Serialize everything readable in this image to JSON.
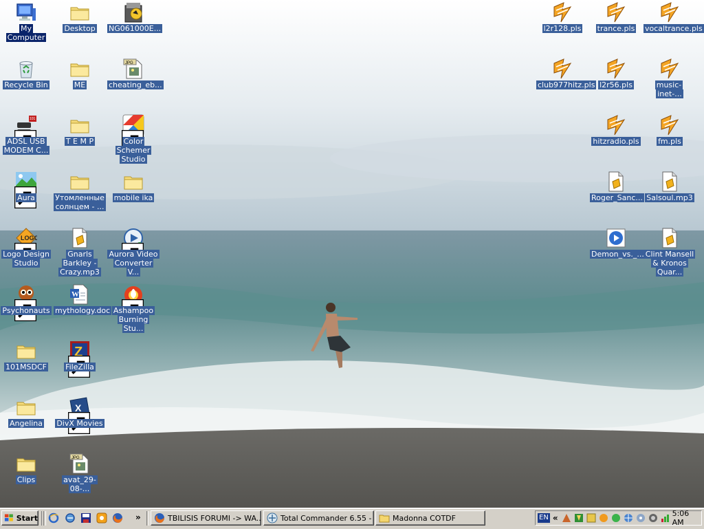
{
  "desktop": {
    "icons": [
      {
        "label": "My Computer",
        "icon": "computer-icon",
        "shortcut": false,
        "selected": true
      },
      {
        "label": "Recycle Bin",
        "icon": "recycle-bin-icon",
        "shortcut": false
      },
      {
        "label": "ADSL USB MODEM C...",
        "icon": "modem-icon",
        "shortcut": true
      },
      {
        "label": "Aura",
        "icon": "landscape-icon",
        "shortcut": true
      },
      {
        "label": "Logo Design Studio",
        "icon": "logo-icon",
        "shortcut": true
      },
      {
        "label": "Psychonauts",
        "icon": "game-character-icon",
        "shortcut": true
      },
      {
        "label": "101MSDCF",
        "icon": "folder-icon",
        "shortcut": false
      },
      {
        "label": "Angelina",
        "icon": "folder-icon",
        "shortcut": false
      },
      {
        "label": "Clips",
        "icon": "folder-icon",
        "shortcut": false
      },
      {
        "label": "Desktop",
        "icon": "folder-icon",
        "shortcut": false
      },
      {
        "label": "ME",
        "icon": "folder-icon",
        "shortcut": false
      },
      {
        "label": "T E M P",
        "icon": "folder-icon",
        "shortcut": false
      },
      {
        "label": "Утомленные солнцем - ...",
        "icon": "folder-icon",
        "shortcut": false
      },
      {
        "label": "Gnarls Barkley - Crazy.mp3",
        "icon": "audio-file-icon",
        "shortcut": false
      },
      {
        "label": "mythology.doc",
        "icon": "word-doc-icon",
        "shortcut": false
      },
      {
        "label": "FileZilla",
        "icon": "filezilla-icon",
        "shortcut": true
      },
      {
        "label": "DivX Movies",
        "icon": "divx-icon",
        "shortcut": true
      },
      {
        "label": "avat_29-08-...",
        "icon": "jpg-file-icon",
        "shortcut": false
      },
      {
        "label": "NG061000E...",
        "icon": "archive-icon",
        "shortcut": false
      },
      {
        "label": "cheating_eb...",
        "icon": "jpg-file-icon",
        "shortcut": false
      },
      {
        "label": "Color Schemer Studio",
        "icon": "color-schemer-icon",
        "shortcut": true
      },
      {
        "label": "mobile ika",
        "icon": "folder-icon",
        "shortcut": false
      },
      {
        "label": "Aurora Video Converter V...",
        "icon": "video-converter-icon",
        "shortcut": true
      },
      {
        "label": "Ashampoo Burning Stu...",
        "icon": "burning-disc-icon",
        "shortcut": true
      },
      {
        "label": "l2r128.pls",
        "icon": "winamp-playlist-icon",
        "shortcut": false
      },
      {
        "label": "club977hitz.pls",
        "icon": "winamp-playlist-icon",
        "shortcut": false
      },
      {
        "label": "trance.pls",
        "icon": "winamp-playlist-icon",
        "shortcut": false
      },
      {
        "label": "l2r56.pls",
        "icon": "winamp-playlist-icon",
        "shortcut": false
      },
      {
        "label": "hitzradio.pls",
        "icon": "winamp-playlist-icon",
        "shortcut": false
      },
      {
        "label": "Roger_Sanc...",
        "icon": "audio-file-icon",
        "shortcut": false
      },
      {
        "label": "Demon_vs._...",
        "icon": "media-file-icon",
        "shortcut": false
      },
      {
        "label": "vocaltrance.pls",
        "icon": "winamp-playlist-icon",
        "shortcut": false
      },
      {
        "label": "music-inet-...",
        "icon": "winamp-playlist-icon",
        "shortcut": false
      },
      {
        "label": "fm.pls",
        "icon": "winamp-playlist-icon",
        "shortcut": false
      },
      {
        "label": "Salsoul.mp3",
        "icon": "audio-file-icon",
        "shortcut": false
      },
      {
        "label": "Clint Mansell & Kronos Quar...",
        "icon": "audio-file-icon",
        "shortcut": false
      }
    ]
  },
  "taskbar": {
    "start_label": "Start",
    "quick_launch": [
      "ie-icon",
      "ie-icon",
      "save-icon",
      "orange-app-icon",
      "firefox-icon"
    ],
    "chevron": "»",
    "tasks": [
      {
        "label": "TBILISIS FORUMI -> WA...",
        "icon": "firefox-icon"
      },
      {
        "label": "Total Commander 6.55 - ...",
        "icon": "total-commander-icon"
      },
      {
        "label": "Madonna COTDF",
        "icon": "folder-icon"
      }
    ],
    "tray": {
      "language": "EN",
      "expand": "«",
      "icons": [
        "app-tray-icon",
        "winamp-tray-icon",
        "green-tray-icon",
        "orange-tray-icon",
        "network-tray-icon",
        "globe-tray-icon",
        "disc-tray-icon",
        "volume-tray-icon",
        "signal-tray-icon"
      ],
      "clock": "5:06 AM"
    }
  },
  "colors": {
    "taskbar": "#d4d0c8",
    "label_bg": "#3a5f9a",
    "selected_label_bg": "#0a246a"
  }
}
